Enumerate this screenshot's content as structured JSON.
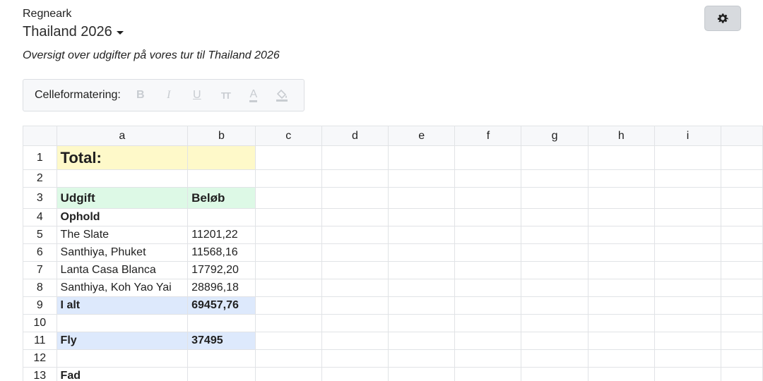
{
  "header": {
    "app_label": "Regneark",
    "doc_title": "Thailand 2026",
    "subtitle": "Oversigt over udgifter på vores tur til Thailand 2026",
    "settings_icon": "gear-icon"
  },
  "toolbar": {
    "label": "Celleformatering:",
    "buttons": [
      {
        "name": "bold-button",
        "glyph": "B",
        "icon": "bold-icon"
      },
      {
        "name": "italic-button",
        "glyph": "I",
        "icon": "italic-icon"
      },
      {
        "name": "underline-button",
        "glyph": "U",
        "icon": "underline-icon"
      },
      {
        "name": "text-size-button",
        "glyph": "TT",
        "icon": "text-size-icon"
      },
      {
        "name": "text-color-button",
        "glyph": "A",
        "icon": "text-color-icon"
      },
      {
        "name": "fill-color-button",
        "glyph": "",
        "icon": "paint-bucket-icon"
      }
    ]
  },
  "sheet": {
    "columns": [
      "a",
      "b",
      "c",
      "d",
      "e",
      "f",
      "g",
      "h",
      "i"
    ],
    "rows": [
      {
        "num": "1",
        "a": "Total:",
        "b": "",
        "style": "total"
      },
      {
        "num": "2",
        "a": "",
        "b": "",
        "style": ""
      },
      {
        "num": "3",
        "a": "Udgift",
        "b": "Beløb",
        "style": "header"
      },
      {
        "num": "4",
        "a": "Ophold",
        "b": "",
        "style": "section"
      },
      {
        "num": "5",
        "a": "The Slate",
        "b": "11201,22",
        "style": ""
      },
      {
        "num": "6",
        "a": "Santhiya, Phuket",
        "b": "11568,16",
        "style": ""
      },
      {
        "num": "7",
        "a": "Lanta Casa Blanca",
        "b": "17792,20",
        "style": ""
      },
      {
        "num": "8",
        "a": "Santhiya, Koh Yao Yai",
        "b": "28896,18",
        "style": ""
      },
      {
        "num": "9",
        "a": "I alt",
        "b": "69457,76",
        "style": "sum"
      },
      {
        "num": "10",
        "a": "",
        "b": "",
        "style": ""
      },
      {
        "num": "11",
        "a": "Fly",
        "b": "37495",
        "style": "sum"
      },
      {
        "num": "12",
        "a": "",
        "b": "",
        "style": ""
      },
      {
        "num": "13",
        "a": "Fad",
        "b": "",
        "style": "section"
      }
    ]
  }
}
